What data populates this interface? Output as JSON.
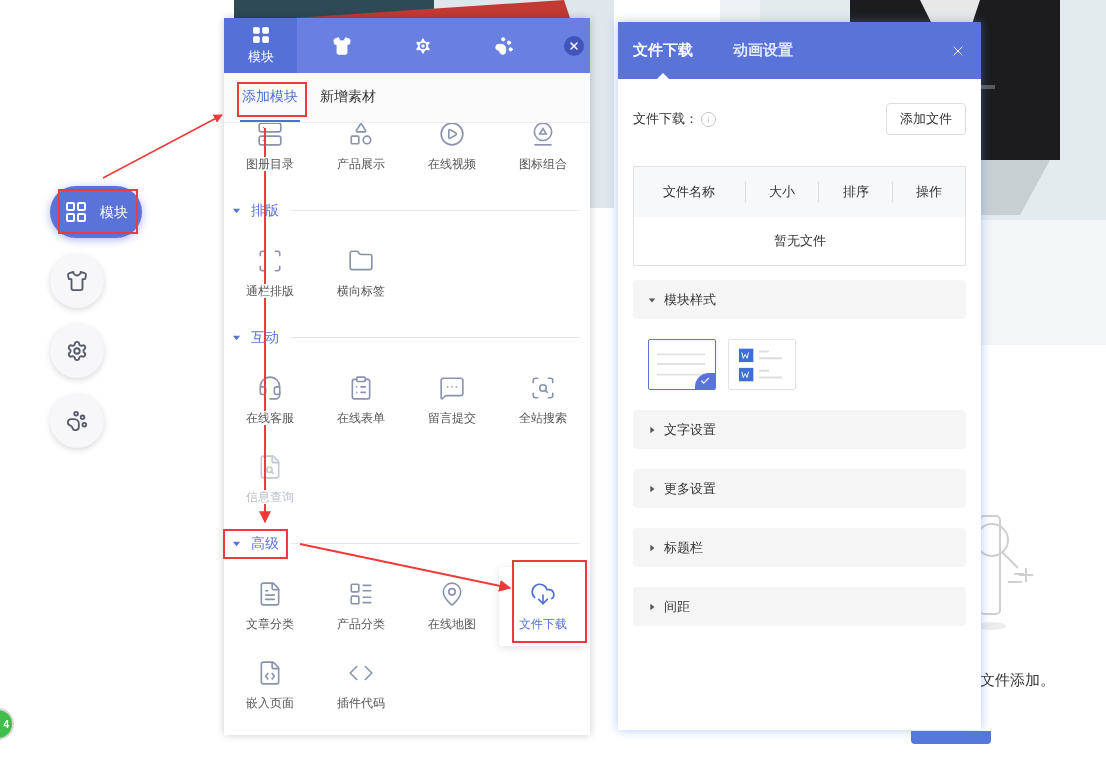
{
  "dock": {
    "items": [
      {
        "label": "模块",
        "selected": true
      },
      {
        "selected": false
      },
      {
        "selected": false
      },
      {
        "selected": false
      }
    ]
  },
  "background": {
    "hint_text": "文件添加。",
    "badge": "4"
  },
  "module_panel": {
    "tabs": [
      {
        "label": "模块",
        "selected": true
      },
      {
        "selected": false
      },
      {
        "selected": false
      },
      {
        "selected": false
      }
    ],
    "subtabs": [
      {
        "label": "添加模块",
        "selected": true
      },
      {
        "label": "新增素材",
        "selected": false
      }
    ],
    "sections": [
      {
        "items": [
          {
            "label": "图册目录",
            "selected": false,
            "disabled": false
          },
          {
            "label": "产品展示",
            "selected": false,
            "disabled": false
          },
          {
            "label": "在线视频",
            "selected": false,
            "disabled": false
          },
          {
            "label": "图标组合",
            "selected": false,
            "disabled": false
          }
        ]
      },
      {
        "title": "排版",
        "expanded": true,
        "items": [
          {
            "label": "通栏排版",
            "selected": false,
            "disabled": false
          },
          {
            "label": "横向标签",
            "selected": false,
            "disabled": false
          }
        ]
      },
      {
        "title": "互动",
        "expanded": true,
        "items": [
          {
            "label": "在线客服",
            "selected": false,
            "disabled": false
          },
          {
            "label": "在线表单",
            "selected": false,
            "disabled": false
          },
          {
            "label": "留言提交",
            "selected": false,
            "disabled": false
          },
          {
            "label": "全站搜索",
            "selected": false,
            "disabled": false
          },
          {
            "label": "信息查询",
            "selected": false,
            "disabled": true
          }
        ]
      },
      {
        "title": "高级",
        "expanded": true,
        "items": [
          {
            "label": "文章分类",
            "selected": false,
            "disabled": false
          },
          {
            "label": "产品分类",
            "selected": false,
            "disabled": false
          },
          {
            "label": "在线地图",
            "selected": false,
            "disabled": false
          },
          {
            "label": "文件下载",
            "selected": true,
            "disabled": false
          },
          {
            "label": "嵌入页面",
            "selected": false,
            "disabled": false
          },
          {
            "label": "插件代码",
            "selected": false,
            "disabled": false
          }
        ]
      }
    ]
  },
  "settings_panel": {
    "tabs": [
      {
        "label": "文件下载",
        "selected": true
      },
      {
        "label": "动画设置",
        "selected": false
      }
    ],
    "files": {
      "label": "文件下载：",
      "add_button": "添加文件",
      "columns": [
        "文件名称",
        "大小",
        "排序",
        "操作"
      ],
      "empty_text": "暂无文件"
    },
    "sections": [
      {
        "title": "模块样式",
        "expanded": true,
        "styles": [
          {
            "selected": true
          },
          {
            "selected": false
          }
        ]
      },
      {
        "title": "文字设置",
        "expanded": false
      },
      {
        "title": "更多设置",
        "expanded": false
      },
      {
        "title": "标题栏",
        "expanded": false
      },
      {
        "title": "间距",
        "expanded": false
      }
    ]
  }
}
